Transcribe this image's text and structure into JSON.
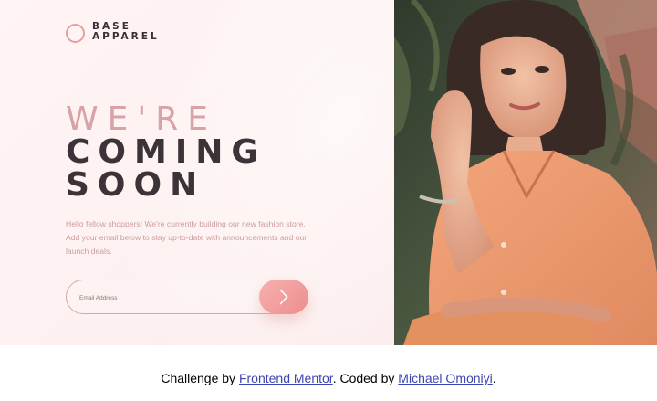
{
  "brand": {
    "line1": "BASE",
    "line2": "APPAREL",
    "accent_color": "#e79e9e"
  },
  "hero": {
    "headline_light": "WE'RE",
    "headline_dark_1": "COMING",
    "headline_dark_2": "SOON",
    "description": "Hello fellow shoppers! We're currently building our new fashion store. Add your email below to stay up-to-date with announcements and our launch deals."
  },
  "form": {
    "email_placeholder": "Email Address",
    "email_value": "",
    "submit_icon": "chevron-right-icon"
  },
  "image": {
    "subject": "woman-in-peach-shirt-photo"
  },
  "footer": {
    "prefix": "Challenge by ",
    "challenge_link": "Frontend Mentor",
    "middle": ". Coded by ",
    "author_link": "Michael Omoniyi",
    "suffix": "."
  },
  "colors": {
    "headline_light": "#d8a3a7",
    "headline_dark": "#3b3338",
    "text_muted": "#cd9c9c",
    "button_start": "#f6b0ae",
    "button_end": "#ee8d8f",
    "link": "#3c44b4"
  }
}
